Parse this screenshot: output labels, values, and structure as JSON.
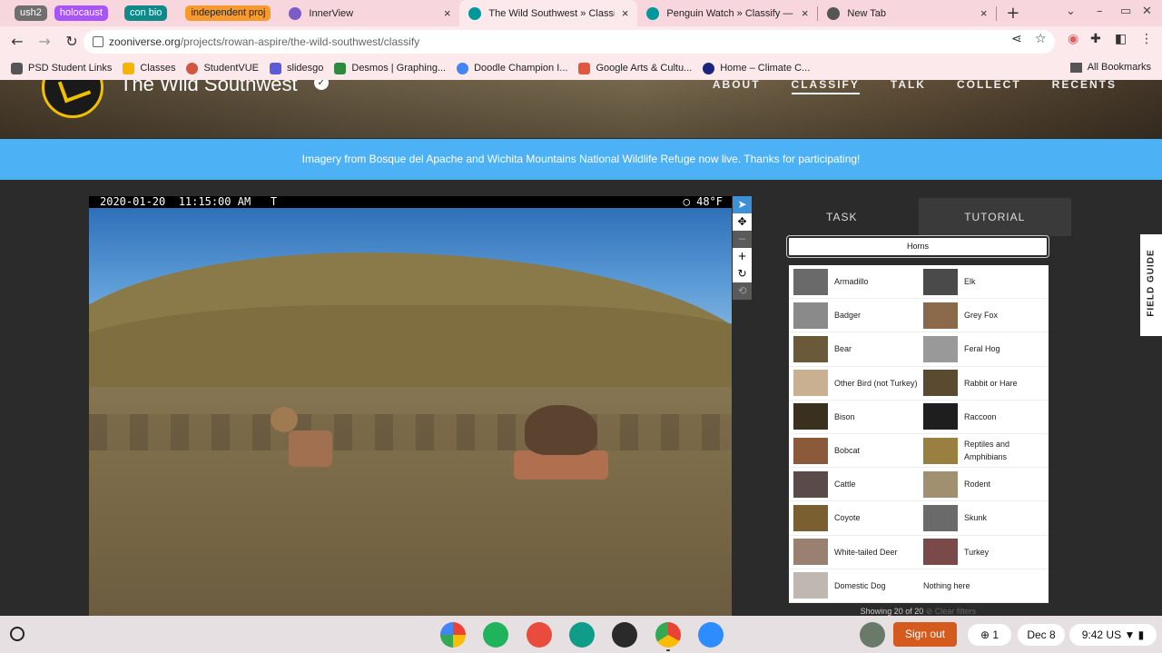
{
  "browser": {
    "tab_groups": [
      {
        "label": "ush2",
        "color": "#6f6f6f"
      },
      {
        "label": "holocaust",
        "color": "#a855f7"
      },
      {
        "label": "con bio",
        "color": "#0f8a8a"
      },
      {
        "label": "independent proj",
        "color": "#f79a2e"
      }
    ],
    "tabs": [
      {
        "title": "InnerView",
        "close": "×",
        "favicon_color": "#7a5cc7"
      },
      {
        "title": "The Wild Southwest » Classify",
        "close": "×",
        "favicon_color": "#00979d"
      },
      {
        "title": "Penguin Watch » Classify — Zo",
        "close": "×",
        "favicon_color": "#00979d"
      },
      {
        "title": "New Tab",
        "close": "×",
        "favicon_color": "#555555"
      }
    ],
    "new_tab": "+",
    "url_domain": "zooniverse.org",
    "url_path": "/projects/rowan-aspire/the-wild-southwest/classify",
    "bookmarks": [
      {
        "label": "PSD Student Links",
        "color": "#555555"
      },
      {
        "label": "Classes",
        "color": "#f4b400"
      },
      {
        "label": "StudentVUE",
        "color": "#d2553d"
      },
      {
        "label": "slidesgo",
        "color": "#5b5bd6"
      },
      {
        "label": "Desmos | Graphing...",
        "color": "#2e8b3d"
      },
      {
        "label": "Doodle Champion I...",
        "color": "#4285f4"
      },
      {
        "label": "Google Arts & Cultu...",
        "color": "#e0563e"
      },
      {
        "label": "Home – Climate C...",
        "color": "#1a237e"
      }
    ],
    "all_bookmarks": "All Bookmarks"
  },
  "project": {
    "title": "The Wild Southwest",
    "nav": [
      "ABOUT",
      "CLASSIFY",
      "TALK",
      "COLLECT",
      "RECENTS"
    ],
    "active_nav": "CLASSIFY",
    "announcement": "Imagery from Bosque del Apache and Wichita Mountains National Wildlife Refuge now live. Thanks for participating!"
  },
  "subject": {
    "timestamp": "2020-01-20  11:15:00 AM   T",
    "temp": "◯   48°F"
  },
  "task_panel": {
    "tabs": [
      "TASK",
      "TUTORIAL"
    ],
    "filter_label": "Horns",
    "choices": [
      {
        "name": "Armadillo",
        "color": "#6a6a6a"
      },
      {
        "name": "Elk",
        "color": "#4a4a4a"
      },
      {
        "name": "Badger",
        "color": "#8a8a8a"
      },
      {
        "name": "Grey Fox",
        "color": "#8a6a4a"
      },
      {
        "name": "Bear",
        "color": "#6a5a3a"
      },
      {
        "name": "Feral Hog",
        "color": "#999999"
      },
      {
        "name": "Other Bird (not Turkey)",
        "color": "#c8b090"
      },
      {
        "name": "Rabbit or Hare",
        "color": "#5a4a30"
      },
      {
        "name": "Bison",
        "color": "#3a3020"
      },
      {
        "name": "Raccoon",
        "color": "#1e1e1e"
      },
      {
        "name": "Bobcat",
        "color": "#8a5a3a"
      },
      {
        "name": "Reptiles and Amphibians",
        "color": "#9a8040"
      },
      {
        "name": "Cattle",
        "color": "#5a4a4a"
      },
      {
        "name": "Rodent",
        "color": "#a09070"
      },
      {
        "name": "Coyote",
        "color": "#7a6030"
      },
      {
        "name": "Skunk",
        "color": "#6a6a6a"
      },
      {
        "name": "White-tailed Deer",
        "color": "#9a8070"
      },
      {
        "name": "Turkey",
        "color": "#7a4a4a"
      },
      {
        "name": "Domestic Dog",
        "color": "#c0b8b0"
      },
      {
        "name": "Nothing here",
        "color": ""
      }
    ],
    "showing": "Showing 20 of 20",
    "clear_filters": "⊘ Clear filters"
  },
  "field_guide": "FIELD GUIDE",
  "shelf": {
    "sign_out": "Sign out",
    "notifications": "1",
    "date": "Dec 8",
    "time": "9:42",
    "locale": "US"
  }
}
